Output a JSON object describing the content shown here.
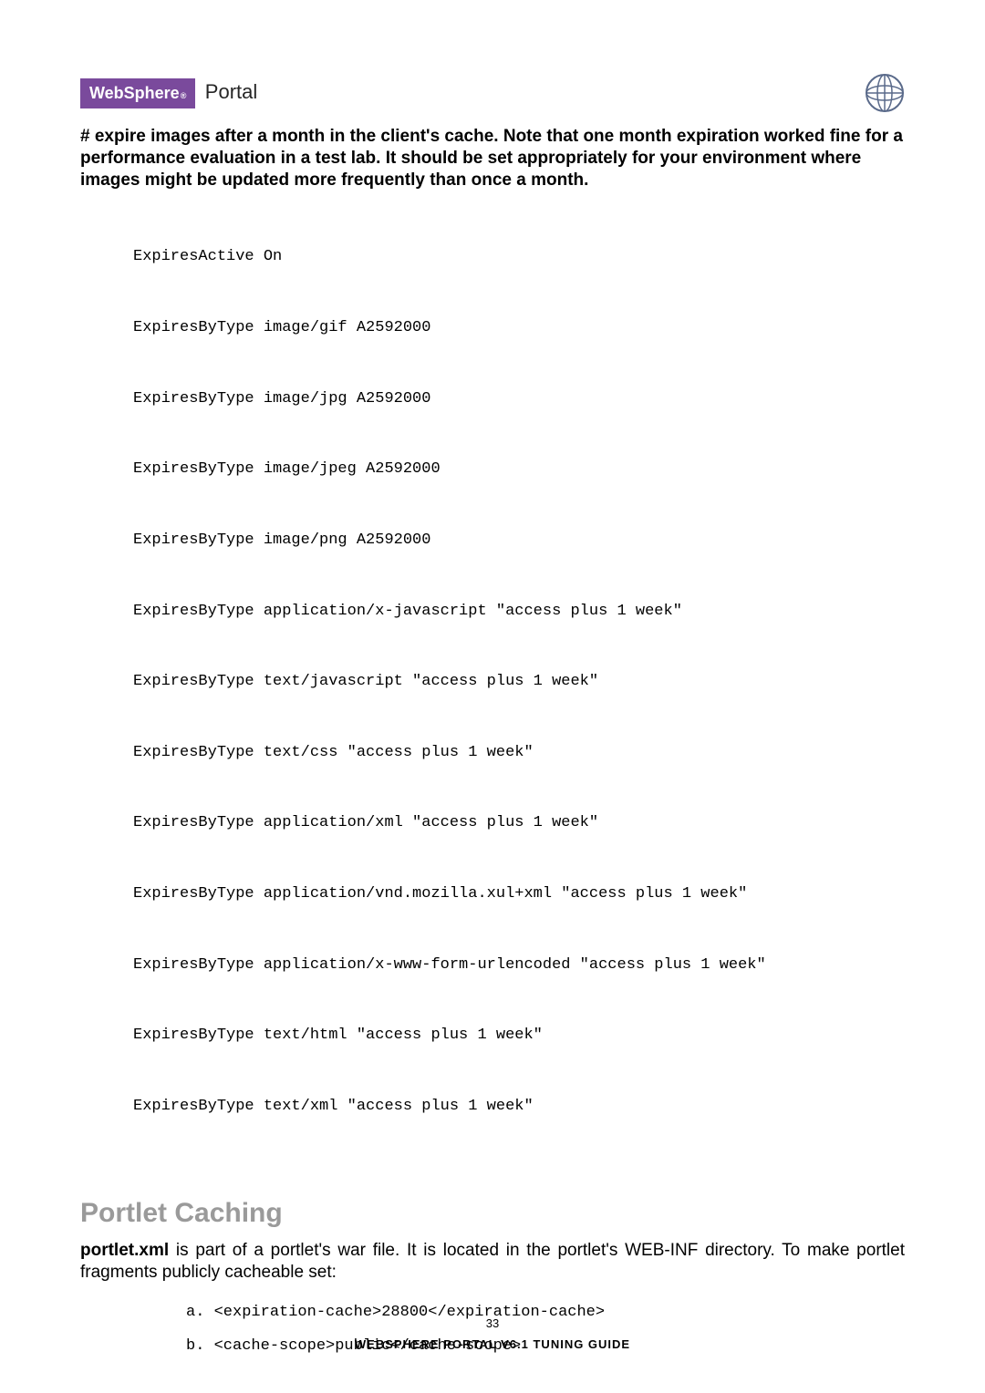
{
  "brand": {
    "name": "WebSphere",
    "sub": "®",
    "portal": "Portal"
  },
  "intro": "# expire images after a month in the client's cache.  Note that one month expiration worked fine for a performance evaluation in a test lab. It should be set appropriately for your environment where images might be updated more frequently than once a month.",
  "code": [
    "ExpiresActive On",
    "ExpiresByType image/gif A2592000",
    "ExpiresByType image/jpg A2592000",
    "ExpiresByType image/jpeg A2592000",
    "ExpiresByType image/png A2592000",
    "ExpiresByType application/x-javascript \"access plus 1 week\"",
    "ExpiresByType text/javascript \"access plus 1 week\"",
    "ExpiresByType text/css \"access plus 1 week\"",
    "ExpiresByType application/xml \"access plus 1 week\"",
    "ExpiresByType application/vnd.mozilla.xul+xml \"access plus 1 week\"",
    "ExpiresByType application/x-www-form-urlencoded \"access plus 1 week\"",
    "ExpiresByType text/html \"access plus 1 week\"",
    "ExpiresByType text/xml \"access plus 1 week\""
  ],
  "section_heading": "Portlet Caching",
  "body": {
    "bold_lead": "portlet.xml",
    "rest": " is part of a portlet's war file. It is located in the portlet's WEB-INF directory. To make portlet fragments publicly cacheable set:"
  },
  "list": [
    "a. <expiration-cache>28800</expiration-cache>",
    "b. <cache-scope>public</cache-scope>"
  ],
  "footer": {
    "page_number": "33",
    "title": "WEBSPHERE PORTAL V6.1 TUNING GUIDE"
  }
}
